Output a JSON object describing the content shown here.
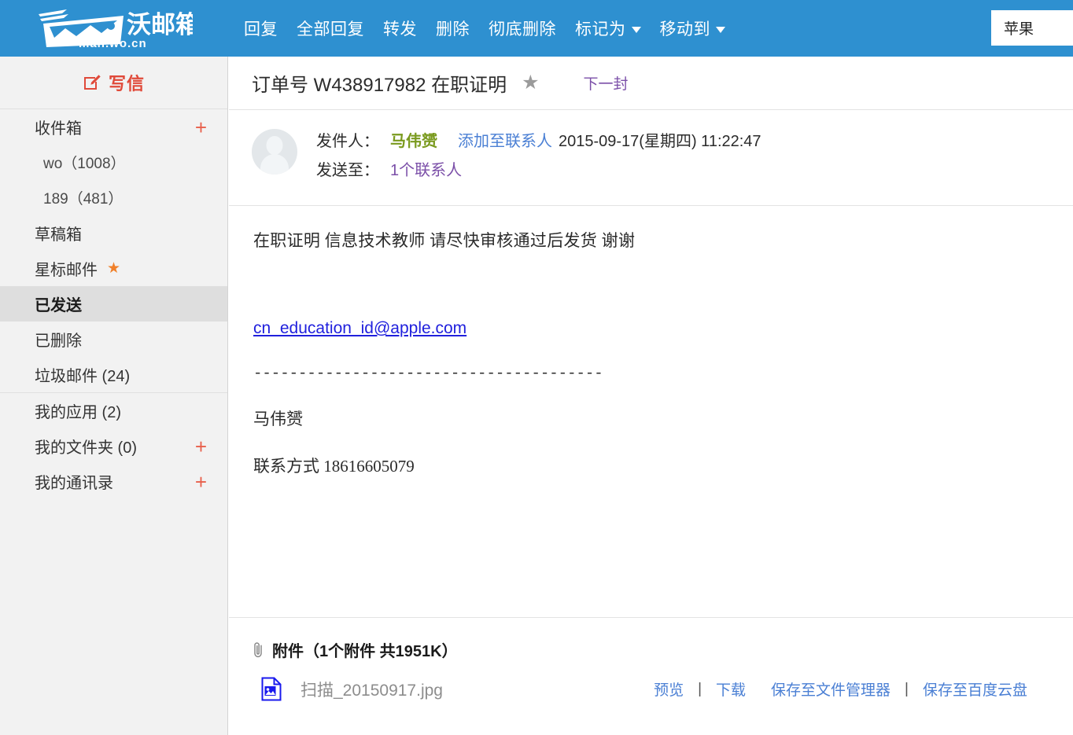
{
  "brand": {
    "name": "沃邮箱",
    "domain": "mail.wo.cn"
  },
  "topnav": {
    "items": [
      {
        "label": "回复",
        "caret": false
      },
      {
        "label": "全部回复",
        "caret": false
      },
      {
        "label": "转发",
        "caret": false
      },
      {
        "label": "删除",
        "caret": false
      },
      {
        "label": "彻底删除",
        "caret": false
      },
      {
        "label": "标记为",
        "caret": true
      },
      {
        "label": "移动到",
        "caret": true
      }
    ],
    "account_label": "苹果"
  },
  "sidebar": {
    "compose_label": "写信",
    "groups": [
      {
        "items": [
          {
            "label": "收件箱",
            "plus": "+",
            "sub": false,
            "active": false
          },
          {
            "label": "wo（1008）",
            "plus": "",
            "sub": true,
            "active": false
          },
          {
            "label": "189（481）",
            "plus": "",
            "sub": true,
            "active": false
          },
          {
            "label": "草稿箱",
            "plus": "",
            "sub": false,
            "active": false
          },
          {
            "label": "星标邮件",
            "plus": "",
            "sub": false,
            "active": false,
            "star": "★"
          },
          {
            "label": "已发送",
            "plus": "",
            "sub": false,
            "active": true
          },
          {
            "label": "已删除",
            "plus": "",
            "sub": false,
            "active": false
          },
          {
            "label": "垃圾邮件 (24)",
            "plus": "",
            "sub": false,
            "active": false
          }
        ]
      },
      {
        "divided": true,
        "items": [
          {
            "label": "我的应用 (2)",
            "plus": "",
            "sub": false,
            "active": false
          },
          {
            "label": "我的文件夹 (0)",
            "plus": "+",
            "sub": false,
            "active": false
          },
          {
            "label": "我的通讯录",
            "plus": "+",
            "sub": false,
            "active": false
          }
        ]
      }
    ]
  },
  "mail": {
    "subject": "订单号 W438917982 在职证明",
    "star_glyph": "★",
    "next_label": "下一封",
    "from_label": "发件人：",
    "from_name": "马伟赟",
    "add_contact_label": "添加至联系人",
    "date": "2015-09-17(星期四) 11:22:47",
    "to_label": "发送至：",
    "to_value": "1个联系人",
    "body": {
      "line1": "在职证明 信息技术教师 请尽快审核通过后发货 谢谢",
      "email": "cn_education_id@apple.com",
      "dashes": "---------------------------------------",
      "sig_name": "马伟赟",
      "sig_contact": "联系方式 18616605079"
    }
  },
  "attachment": {
    "header": "附件（1个附件 共1951K）",
    "file_name": "扫描_20150917.jpg",
    "actions": {
      "preview": "预览",
      "download": "下载",
      "save_file_manager": "保存至文件管理器",
      "save_baidu": "保存至百度云盘",
      "separator": "|"
    }
  },
  "colors": {
    "brand_blue": "#2e90d0",
    "accent_red": "#e04a3a",
    "link_blue": "#4a7fd4",
    "link_purple": "#7b4fa8",
    "sender_green": "#7a9a1e",
    "email_blue": "#2020dd",
    "star_orange": "#f0802a"
  }
}
